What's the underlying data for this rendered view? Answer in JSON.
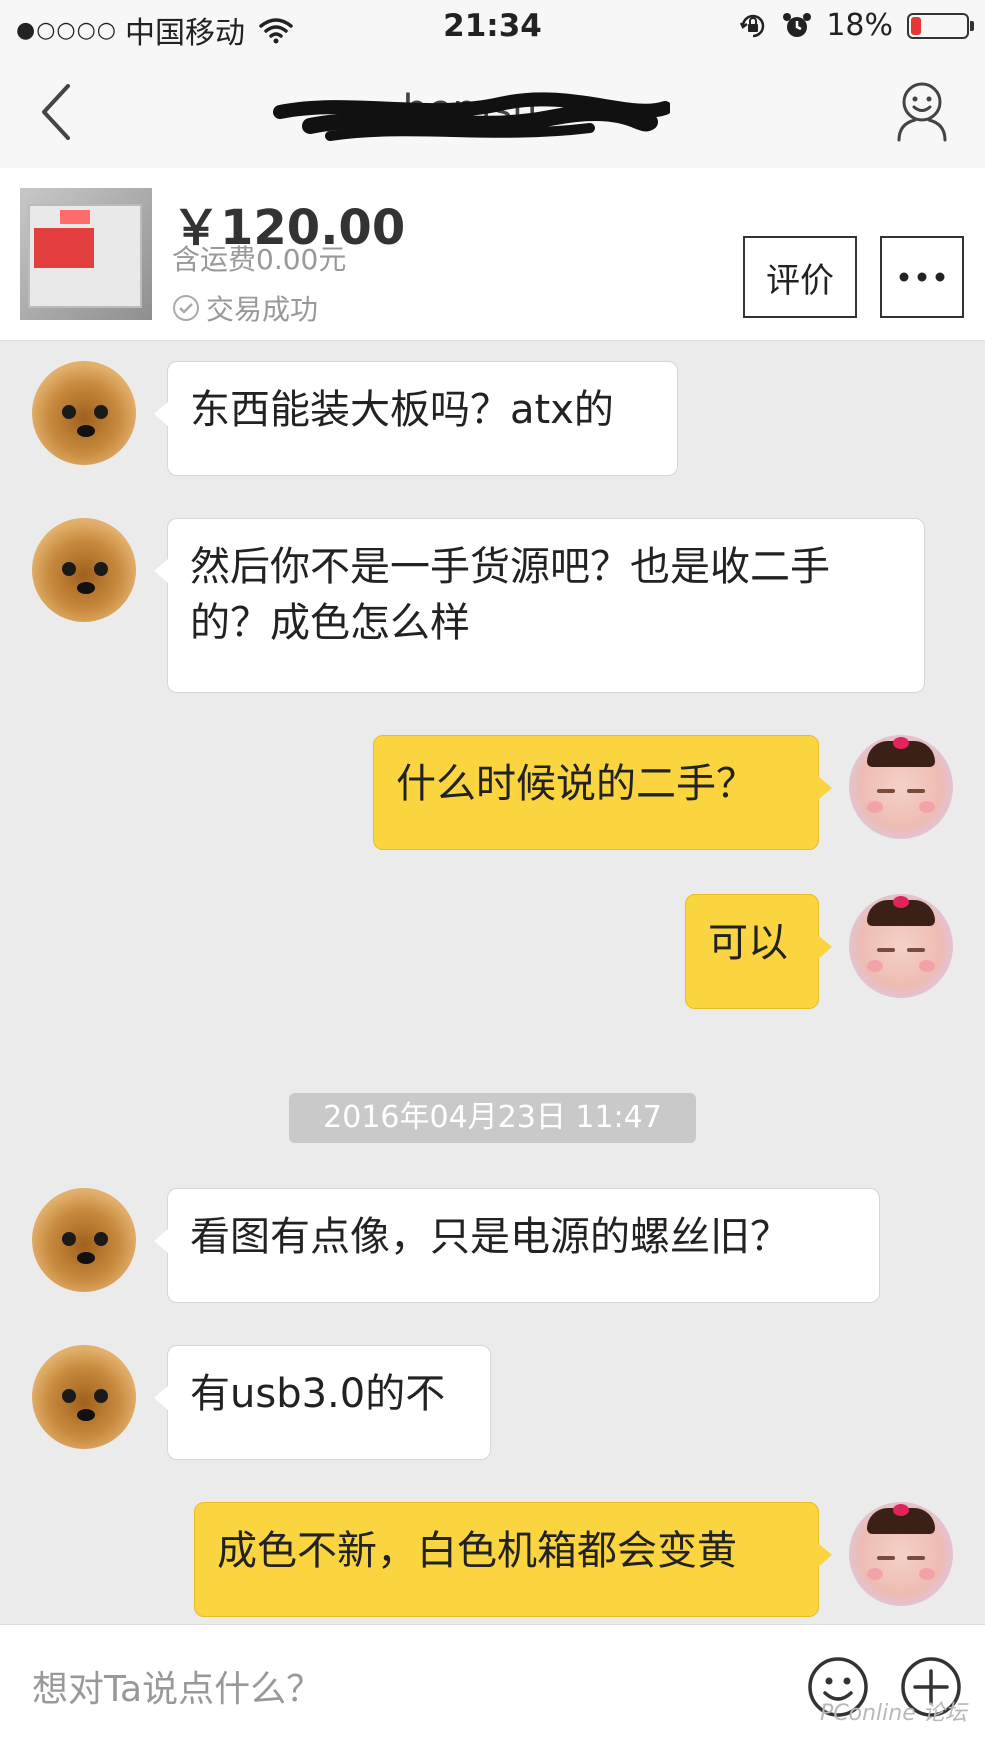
{
  "status_bar": {
    "signal_dots": "●○○○○",
    "carrier": "中国移动",
    "time": "21:34",
    "battery_percent": "18%",
    "battery_level": 0.18,
    "battery_color": "#e53935"
  },
  "nav": {
    "back_icon": "chevron-left-icon",
    "title": "hemsu",
    "profile_icon": "user-profile-icon"
  },
  "product": {
    "price": "￥120.00",
    "shipping": "含运费0.00元",
    "status": "交易成功",
    "review_button": "评价",
    "more_icon": "more-dots-icon"
  },
  "messages": [
    {
      "side": "in",
      "text": "东西能装大板吗？atx的"
    },
    {
      "side": "in",
      "text": "然后你不是一手货源吧？也是收二手的？成色怎么样"
    },
    {
      "side": "out",
      "text": "什么时候说的二手？"
    },
    {
      "side": "out",
      "text": "可以"
    },
    {
      "timestamp": "2016年04月23日 11:47"
    },
    {
      "side": "in",
      "text": "看图有点像，只是电源的螺丝旧？"
    },
    {
      "side": "in",
      "text": "有usb3.0的不"
    },
    {
      "side": "out",
      "text": "成色不新，白色机箱都会变黄"
    }
  ],
  "input": {
    "placeholder": "想对Ta说点什么？",
    "emoji_icon": "emoji-smile-icon",
    "plus_icon": "plus-circle-icon"
  },
  "colors": {
    "outgoing_bubble": "#fbd53f",
    "incoming_bubble": "#ffffff",
    "chat_background": "#ebebeb"
  },
  "watermark": "PConline 论坛"
}
